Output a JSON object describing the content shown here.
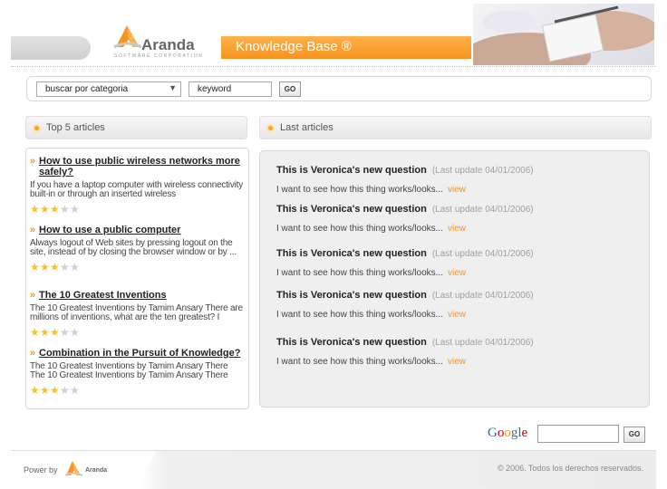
{
  "header": {
    "logo_text": "Aranda",
    "logo_subtext": "SOFTWARE CORPORATION",
    "kb_title": "Knowledge Base ®"
  },
  "search": {
    "category_label": "buscar por categoria",
    "keyword_value": "keyword",
    "go_label": "GO"
  },
  "top5": {
    "heading": "Top 5 articles",
    "articles": [
      {
        "title": "How to use public wireless networks more safely?",
        "desc": "If you have a laptop computer with wireless connectivity built-in or through an inserted wireless",
        "rating": 3
      },
      {
        "title": "How to use a public computer",
        "desc": "Always logout of Web sites by pressing logout on the site, instead of by closing the browser window or by ...",
        "rating": 3
      },
      {
        "title": "The 10 Greatest Inventions",
        "desc": "The 10 Greatest Inventions by Tamim Ansary There are millions of inventions, what are the ten greatest? I",
        "rating": 3
      },
      {
        "title": "Combination in the Pursuit of Knowledge?",
        "desc": "The 10 Greatest Inventions by Tamim Ansary There The 10 Greatest Inventions by Tamim Ansary There",
        "rating": 3
      }
    ]
  },
  "last_articles": {
    "heading": "Last articles",
    "items": [
      {
        "question": "This is Veronica's new question",
        "updated": "(Last update 04/01/2006)",
        "desc": "I want to see how this thing works/looks...",
        "view": "view"
      },
      {
        "question": "This is Veronica's new question",
        "updated": "(Last update 04/01/2006)",
        "desc": "I want to see how this thing works/looks...",
        "view": "view"
      },
      {
        "question": "This is Veronica's new question",
        "updated": "(Last update 04/01/2006)",
        "desc": "I want to see how this thing works/looks...",
        "view": "view"
      },
      {
        "question": "This is Veronica's new question",
        "updated": "(Last update 04/01/2006)",
        "desc": "I want to see how this thing works/looks...",
        "view": "view"
      },
      {
        "question": "This is Veronica's new question",
        "updated": "(Last update 04/01/2006)",
        "desc": "I want to see how this thing works/looks...",
        "view": "view"
      }
    ]
  },
  "google": {
    "letters": [
      "G",
      "o",
      "o",
      "g",
      "l",
      "e"
    ],
    "colors": [
      "#3366cc",
      "#cc0000",
      "#ff9900",
      "#3366cc",
      "#009933",
      "#cc0000"
    ],
    "go_label": "GO"
  },
  "footer": {
    "power_by": "Power by",
    "logo_text": "Aranda",
    "copyright": "© 2006. Todos los derechos reservados."
  },
  "colors": {
    "accent_orange": "#f7931e",
    "star_on": "#f2c230",
    "star_off": "#cfcfcf"
  }
}
